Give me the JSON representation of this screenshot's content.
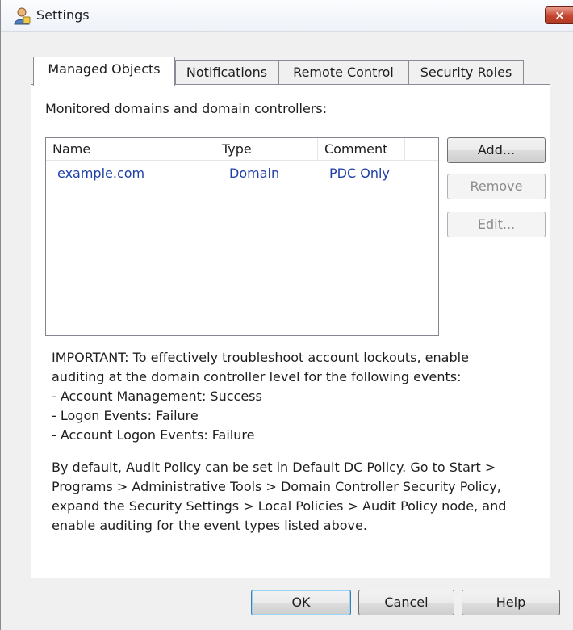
{
  "window": {
    "title": "Settings",
    "close_label": "×"
  },
  "tabs": [
    {
      "label": "Managed Objects",
      "active": true
    },
    {
      "label": "Notifications",
      "active": false
    },
    {
      "label": "Remote Control",
      "active": false
    },
    {
      "label": "Security Roles",
      "active": false
    }
  ],
  "managed_objects": {
    "section_label": "Monitored domains and domain controllers:",
    "columns": [
      "Name",
      "Type",
      "Comment"
    ],
    "rows": [
      {
        "name": "example.com",
        "type": "Domain",
        "comment": "PDC Only"
      }
    ],
    "buttons": {
      "add": "Add...",
      "remove": "Remove",
      "edit": "Edit..."
    },
    "important_lines": [
      "IMPORTANT: To effectively troubleshoot account lockouts, enable",
      "auditing at the domain controller level for the following events:",
      "- Account Management: Success",
      "- Logon Events: Failure",
      "- Account Logon Events: Failure"
    ],
    "default_lines": [
      "By default, Audit Policy can be set in Default DC Policy. Go to Start >",
      "Programs > Administrative Tools > Domain Controller Security Policy,",
      "expand the Security Settings > Local Policies > Audit Policy node, and",
      "enable auditing for the event types listed above."
    ]
  },
  "footer": {
    "ok": "OK",
    "cancel": "Cancel",
    "help": "Help"
  },
  "colors": {
    "link_text": "#1f3fa6",
    "close_button": "#c4452f",
    "dialog_background": "#f0f0f0"
  }
}
